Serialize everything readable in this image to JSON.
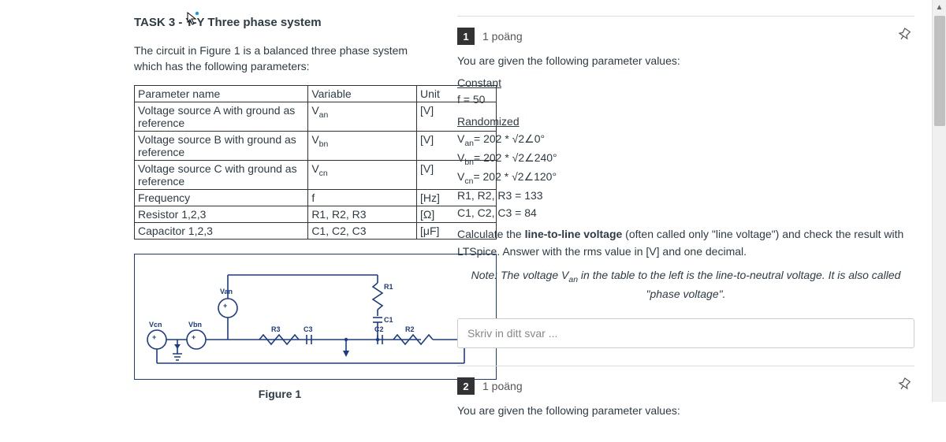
{
  "left": {
    "title": "TASK 3 - Y-Y Three phase system",
    "intro": "The circuit in Figure 1 is a balanced three phase system which has the following parameters:",
    "headers": {
      "name": "Parameter name",
      "var": "Variable",
      "unit": "Unit"
    },
    "rows": [
      {
        "name": "Voltage source A with ground as reference",
        "var_base": "V",
        "var_sub": "an",
        "unit": "[V]"
      },
      {
        "name": "Voltage source B with ground as reference",
        "var_base": "V",
        "var_sub": "bn",
        "unit": "[V]"
      },
      {
        "name": "Voltage source C with ground as reference",
        "var_base": "V",
        "var_sub": "cn",
        "unit": "[V]"
      },
      {
        "name": "Frequency",
        "var_base": "f",
        "var_sub": "",
        "unit": "[Hz]"
      },
      {
        "name": "Resistor 1,2,3",
        "var_base": "R1, R2, R3",
        "var_sub": "",
        "unit": "[Ω]"
      },
      {
        "name": "Capacitor 1,2,3",
        "var_base": "C1, C2, C3",
        "var_sub": "",
        "unit": "[μF]"
      }
    ],
    "schematic": {
      "Van": "Van",
      "Vbn": "Vbn",
      "Vcn": "Vcn",
      "R1": "R1",
      "R2": "R2",
      "R3": "R3",
      "C1": "C1",
      "C2": "C2",
      "C3": "C3",
      "caption": "Figure 1"
    }
  },
  "q1": {
    "num": "1",
    "pts": "1 poäng",
    "intro": "You are given the following parameter values:",
    "const_label": "Constant",
    "const_line": "f = 50",
    "rand_label": "Randomized",
    "van": "= 202 * √2∠0°",
    "vbn": "= 202 * √2∠240°",
    "vcn": "= 202 * √2∠120°",
    "r_line": "R1, R2, R3 = 133",
    "c_line": "C1, C2, C3 = 84",
    "calc1": "Calculate the ",
    "calc1b": "line-to-line voltage",
    "calc1c": " (often called only \"line voltage\") and check the result with LTSpice. Answer with the rms value in [V] and one decimal.",
    "note1": "Note: The voltage V",
    "note_sub": "an",
    "note2": " in the table to the left is the line-to-neutral voltage. It is also called \"phase voltage\".",
    "placeholder": "Skriv in ditt svar ..."
  },
  "q2": {
    "num": "2",
    "pts": "1 poäng",
    "intro": "You are given the following parameter values:"
  }
}
